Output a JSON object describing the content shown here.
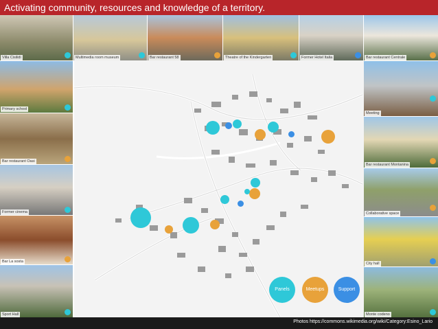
{
  "title": "Activating community, resources and knowledge of a territory.",
  "colors": {
    "panel": "#2ec8d8",
    "meetup": "#e8a23a",
    "support": "#3b8fe4",
    "accent": "#b8252a"
  },
  "top_tiles": [
    {
      "label": "Villa Cisilidi",
      "type": "panel"
    },
    {
      "label": "Multimedia room museum",
      "type": "panel"
    },
    {
      "label": "Bar restaurant 58",
      "type": "meetup"
    },
    {
      "label": "Theatre of the Kindergarten",
      "type": "panel"
    },
    {
      "label": "Former Hotel Italia",
      "type": "support"
    },
    {
      "label": "Bar restaurant Centrale",
      "type": "meetup"
    }
  ],
  "left_tiles": [
    {
      "label": "Primary school",
      "type": "panel"
    },
    {
      "label": "Bar restaurant Oasi",
      "type": "meetup"
    },
    {
      "label": "Former cinema",
      "type": "panel"
    },
    {
      "label": "Bar La sosta",
      "type": "meetup"
    },
    {
      "label": "Sport Hall",
      "type": "panel"
    }
  ],
  "right_tiles": [
    {
      "label": "Meeting",
      "type": "panel"
    },
    {
      "label": "Bar restaurant Montanina",
      "type": "meetup"
    },
    {
      "label": "Collaborative space",
      "type": "meetup"
    },
    {
      "label": "City hall",
      "type": "support"
    },
    {
      "label": "Monte codeno",
      "type": "panel"
    }
  ],
  "legend": {
    "panels": "Panels",
    "meetups": "Meetups",
    "support": "Support"
  },
  "footer_credit": "Photos https://commons.wikimedia.org/wiki/Category:Esino_Lario"
}
